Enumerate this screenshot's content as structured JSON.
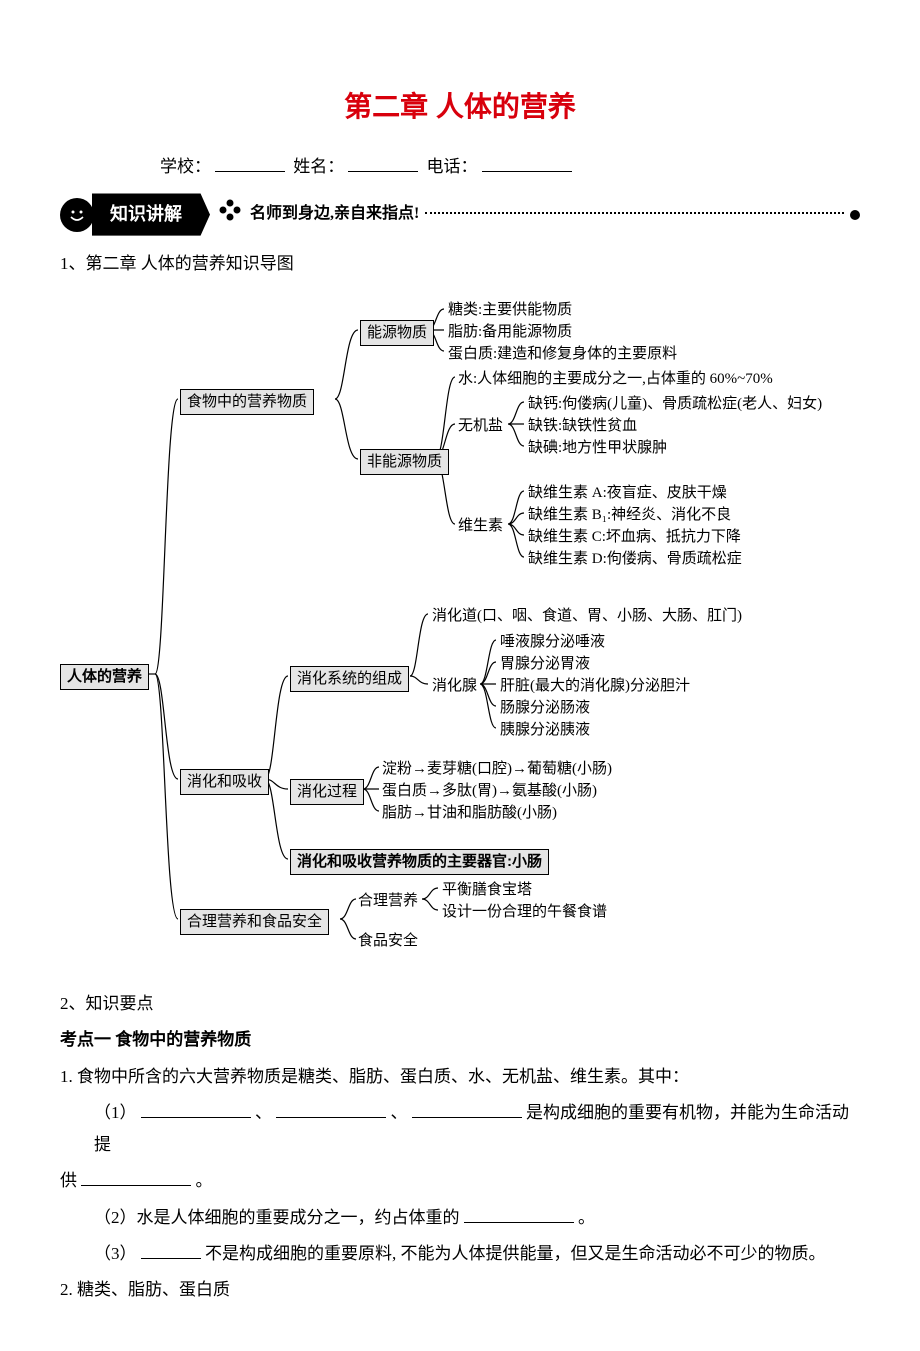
{
  "title": "第二章  人体的营养",
  "meta": {
    "school": "学校：",
    "name": "姓名：",
    "phone": "电话："
  },
  "ribbon": {
    "label": "知识讲解",
    "subtitle": "名师到身边,亲自来指点!"
  },
  "section1_label": "1、第二章  人体的营养知识导图",
  "section2_label": "2、知识要点",
  "kaodian1": "考点一    食物中的营养物质",
  "body": {
    "p1_lead": "1. 食物中所含的六大营养物质是糖类、脂肪、蛋白质、水、无机盐、维生素。其中：",
    "p1_a_prefix": "（1）",
    "p1_a_mid1": "、",
    "p1_a_mid2": "、",
    "p1_a_tail": "是构成细胞的重要有机物，并能为生命活动提",
    "p1_a_cont_lead": "供",
    "p1_a_cont_tail": "。",
    "p1_b": "（2）水是人体细胞的重要成分之一，约占体重的",
    "p1_b_tail": "。",
    "p1_c_lead": "（3）",
    "p1_c_tail": "不是构成细胞的重要原料, 不能为人体提供能量，但又是生命活动必不可少的物质。",
    "p2": "2.  糖类、脂肪、蛋白质"
  },
  "diagram": {
    "root": "人体的营养",
    "food": "食物中的营养物质",
    "energy": "能源物质",
    "energy_items": [
      "糖类:主要供能物质",
      "脂肪:备用能源物质",
      "蛋白质:建造和修复身体的主要原料"
    ],
    "nonenergy": "非能源物质",
    "water": "水:人体细胞的主要成分之一,占体重的 60%~70%",
    "mineral_label": "无机盐",
    "mineral_items": [
      "缺钙:佝偻病(儿童)、骨质疏松症(老人、妇女)",
      "缺铁:缺铁性贫血",
      "缺碘:地方性甲状腺肿"
    ],
    "vitamin_label": "维生素",
    "vitamin_items": [
      "缺维生素 A:夜盲症、皮肤干燥",
      "缺维生素 B₁:神经炎、消化不良",
      "缺维生素 C:坏血病、抵抗力下降",
      "缺维生素 D:佝偻病、骨质疏松症"
    ],
    "digest_absorb": "消化和吸收",
    "digsys": "消化系统的组成",
    "digtract": "消化道(口、咽、食道、胃、小肠、大肠、肛门)",
    "gland_label": "消化腺",
    "gland_items": [
      "唾液腺分泌唾液",
      "胃腺分泌胃液",
      "肝脏(最大的消化腺)分泌胆汁",
      "肠腺分泌肠液",
      "胰腺分泌胰液"
    ],
    "digproc": "消化过程",
    "digproc_items": [
      "淀粉→麦芽糖(口腔)→葡萄糖(小肠)",
      "蛋白质→多肽(胃)→氨基酸(小肠)",
      "脂肪→甘油和脂肪酸(小肠)"
    ],
    "mainorgan": "消化和吸收营养物质的主要器官:小肠",
    "safety": "合理营养和食品安全",
    "heli_label": "合理营养",
    "heli_items": [
      "平衡膳食宝塔",
      "设计一份合理的午餐食谱"
    ],
    "food_safe": "食品安全"
  }
}
